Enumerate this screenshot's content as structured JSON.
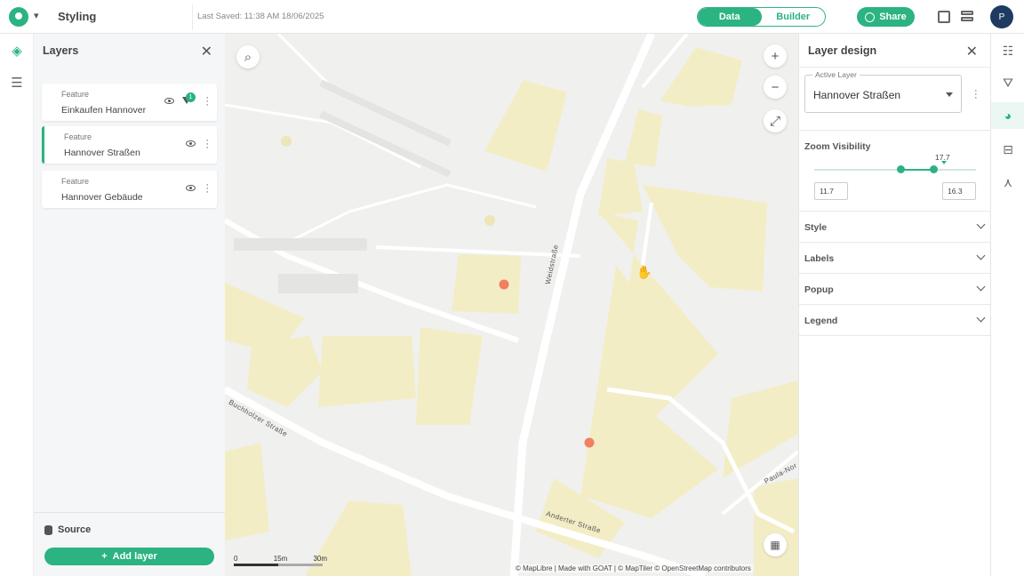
{
  "header": {
    "project_title": "Styling",
    "last_saved": "Last Saved: 11:38 AM 18/06/2025",
    "mode_data": "Data",
    "mode_builder": "Builder",
    "share_label": "Share",
    "avatar_initials": "P"
  },
  "layers_panel": {
    "title": "Layers",
    "close_glyph": "✕",
    "layers": [
      {
        "type": "Feature",
        "name": "Einkaufen Hannover",
        "filter_count": "1"
      },
      {
        "type": "Feature",
        "name": "Hannover Straßen"
      },
      {
        "type": "Feature",
        "name": "Hannover Gebäude"
      }
    ],
    "source_label": "Source",
    "add_layer_label": "Add layer"
  },
  "map": {
    "scale_labels": [
      "0",
      "15m",
      "30m"
    ],
    "attribution": "© MapLibre | Made with GOAT | © MapTiler © OpenStreetMap contributors",
    "streets": [
      "Weidstraße",
      "Anderter Straße",
      "Buchholzer Straße",
      "Paula-Nor"
    ],
    "colors": {
      "building": "#f3edc6",
      "road": "#ffffff",
      "poi": "#f08060",
      "background": "#f0f0ee"
    }
  },
  "design_panel": {
    "title": "Layer design",
    "active_layer_legend": "Active Layer",
    "active_layer_value": "Hannover Straßen",
    "zoom_visibility_title": "Zoom Visibility",
    "zoom_current": "17.7",
    "zoom_min": "11.7",
    "zoom_max": "16.3",
    "sections": [
      "Style",
      "Labels",
      "Popup",
      "Legend"
    ]
  },
  "accent_color": "#2bb381"
}
